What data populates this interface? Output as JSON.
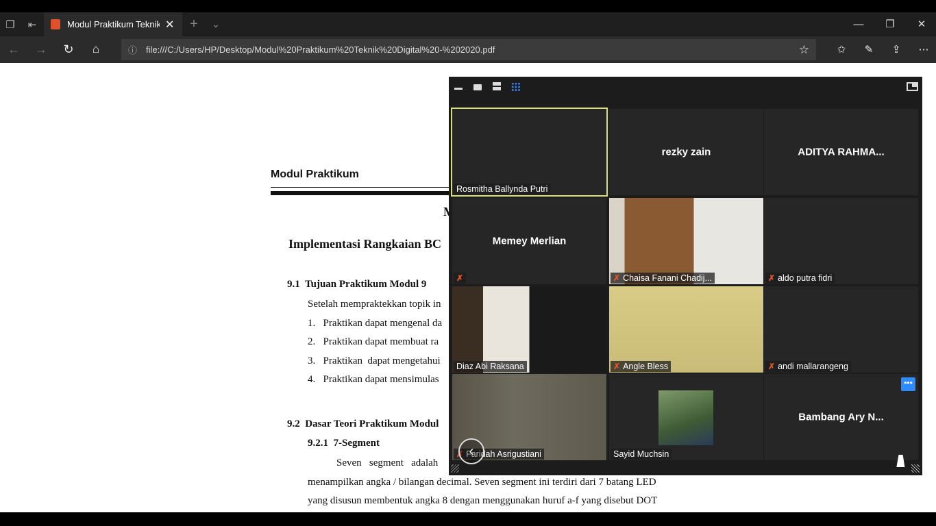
{
  "browser": {
    "tab_title": "Modul Praktikum Teknik",
    "url": "file:///C:/Users/HP/Desktop/Modul%20Praktikum%20Teknik%20Digital%20-%202020.pdf"
  },
  "document": {
    "header": "Modul Praktikum",
    "chapter_partial": "M",
    "title_partial": "Implementasi Rangkaian BC",
    "s91": "9.1  Tujuan Praktikum Modul 9",
    "intro": "Setelah mempraktekkan topik in",
    "items": [
      "1.   Praktikan dapat mengenal da",
      "2.   Praktikan dapat membuat ra",
      "3.   Praktikan  dapat mengetahui",
      "4.   Praktikan dapat mensimulas"
    ],
    "s92": "9.2  Dasar Teori Praktikum Modul",
    "s921": "9.2.1  7-Segment",
    "para1": "Seven   segment   adalah",
    "para2": "menampilkan angka / bilangan decimal. Seven segment ini terdiri dari 7 batang LED",
    "para3": "yang disusun membentuk angka 8 dengan menggunakan huruf a-f yang disebut DOT"
  },
  "meeting": {
    "active_speaker_color": "#d8e07a",
    "participants": [
      {
        "name": "Rosmitha Ballynda Putri",
        "video": false,
        "muted": false,
        "label_only": true
      },
      {
        "name": "rezky zain",
        "video": false,
        "muted": false
      },
      {
        "name": "ADITYA  RAHMA...",
        "video": false,
        "muted": false
      },
      {
        "name": "Memey Merlian",
        "video": false,
        "muted": true
      },
      {
        "name": "Chaisa Fanani Chadij...",
        "video": true,
        "muted": true
      },
      {
        "name": "aldo putra fidri",
        "video": false,
        "muted": true
      },
      {
        "name": "Diaz Abi Raksana",
        "video": true,
        "muted": false
      },
      {
        "name": "Angle Bless",
        "video": true,
        "muted": true
      },
      {
        "name": "andi mallarangeng",
        "video": false,
        "muted": true
      },
      {
        "name": "Faridah Asrigustiani",
        "video": true,
        "muted": true
      },
      {
        "name": "Sayid Muchsin",
        "video": false,
        "muted": false,
        "photo": true
      },
      {
        "name": "Bambang Ary N...",
        "video": false,
        "muted": false
      }
    ]
  }
}
